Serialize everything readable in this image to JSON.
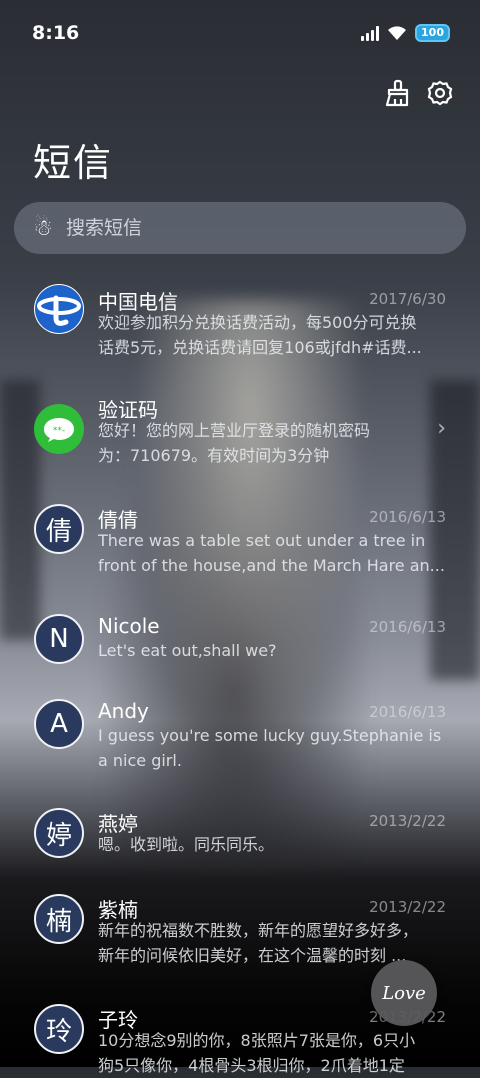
{
  "status_bar": {
    "time": "8:16",
    "battery": "100"
  },
  "header": {
    "title": "短信"
  },
  "search": {
    "placeholder": "搜索短信"
  },
  "messages": [
    {
      "avatar": "",
      "avatar_type": "telecom-logo",
      "name": "中国电信",
      "date": "2017/6/30",
      "lines": [
        "欢迎参加积分兑换话费活动，每500分可兑换",
        "话费5元，兑换话费请回复106或jfdh#话费..."
      ]
    },
    {
      "avatar": "",
      "avatar_type": "chat-icon",
      "name": "验证码",
      "date": "",
      "lines": [
        "您好！您的网上营业厅登录的随机密码",
        "为：710679。有效时间为3分钟"
      ]
    },
    {
      "avatar": "倩",
      "avatar_type": "letter",
      "name": "倩倩",
      "date": "2016/6/13",
      "lines": [
        "There was a table set out under a tree in",
        "front of the house,and the March Hare an..."
      ]
    },
    {
      "avatar": "N",
      "avatar_type": "letter",
      "name": "Nicole",
      "date": "2016/6/13",
      "lines": [
        "Let's eat out,shall we?"
      ]
    },
    {
      "avatar": "A",
      "avatar_type": "letter",
      "name": "Andy",
      "date": "2016/6/13",
      "lines": [
        "I guess you're some lucky guy.Stephanie is",
        "a nice girl."
      ]
    },
    {
      "avatar": "婷",
      "avatar_type": "letter",
      "name": "燕婷",
      "date": "2013/2/22",
      "lines": [
        "嗯。收到啦。同乐同乐。"
      ]
    },
    {
      "avatar": "楠",
      "avatar_type": "letter",
      "name": "紫楠",
      "date": "2013/2/22",
      "lines": [
        "新年的祝福数不胜数，新年的愿望好多好多，",
        "新年的问候依旧美好，在这个温馨的时刻 ..."
      ]
    },
    {
      "avatar": "玲",
      "avatar_type": "letter",
      "name": "子玲",
      "date": "2013/2/22",
      "lines": [
        "10分想念9别的你，8张照片7张是你，6只小",
        "狗5只像你，4根骨头3根归你，2爪着地1定"
      ]
    }
  ],
  "fab": {
    "label": "Love"
  }
}
